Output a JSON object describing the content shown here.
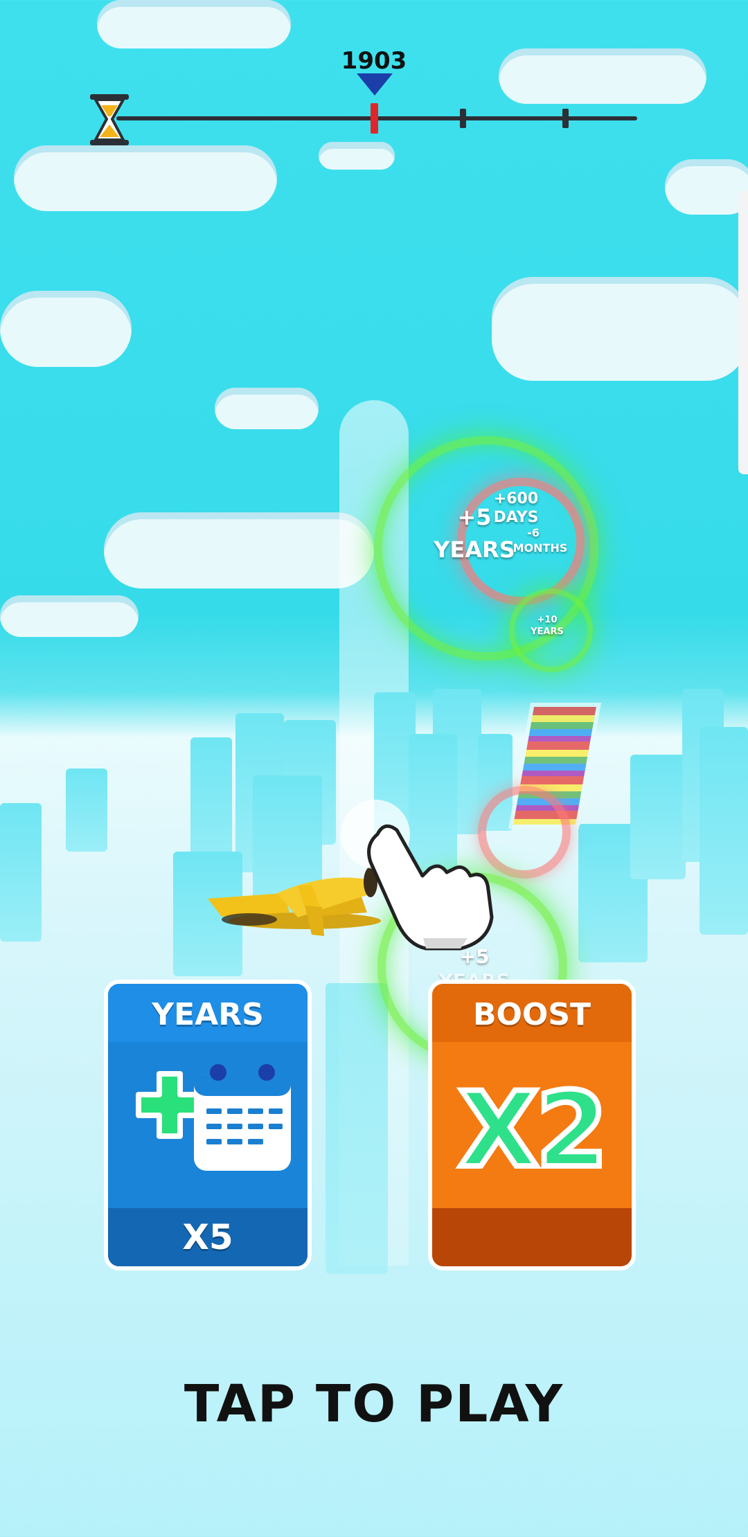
{
  "timeline": {
    "current_year": "1903",
    "icon": "hourglass-icon"
  },
  "portal": {
    "main_value": "+5",
    "main_unit": "YEARS",
    "days_value": "+600",
    "days_unit": "DAYS",
    "months_value": "-6",
    "months_unit": "MONTHS",
    "small_value": "+10",
    "small_unit": "YEARS",
    "lower_value": "+5",
    "lower_unit": "YEARS"
  },
  "cards": {
    "years": {
      "title": "YEARS",
      "multiplier": "X5",
      "icon": "calendar-plus-icon",
      "color": "#1a84d8"
    },
    "boost": {
      "title": "BOOST",
      "value": "X2",
      "color": "#f37b12"
    }
  },
  "tap_to_play": "TAP TO PLAY",
  "colors": {
    "sky": "#3fe0ee",
    "portal_green": "#6ef03c",
    "plane_yellow": "#f2c21a"
  }
}
